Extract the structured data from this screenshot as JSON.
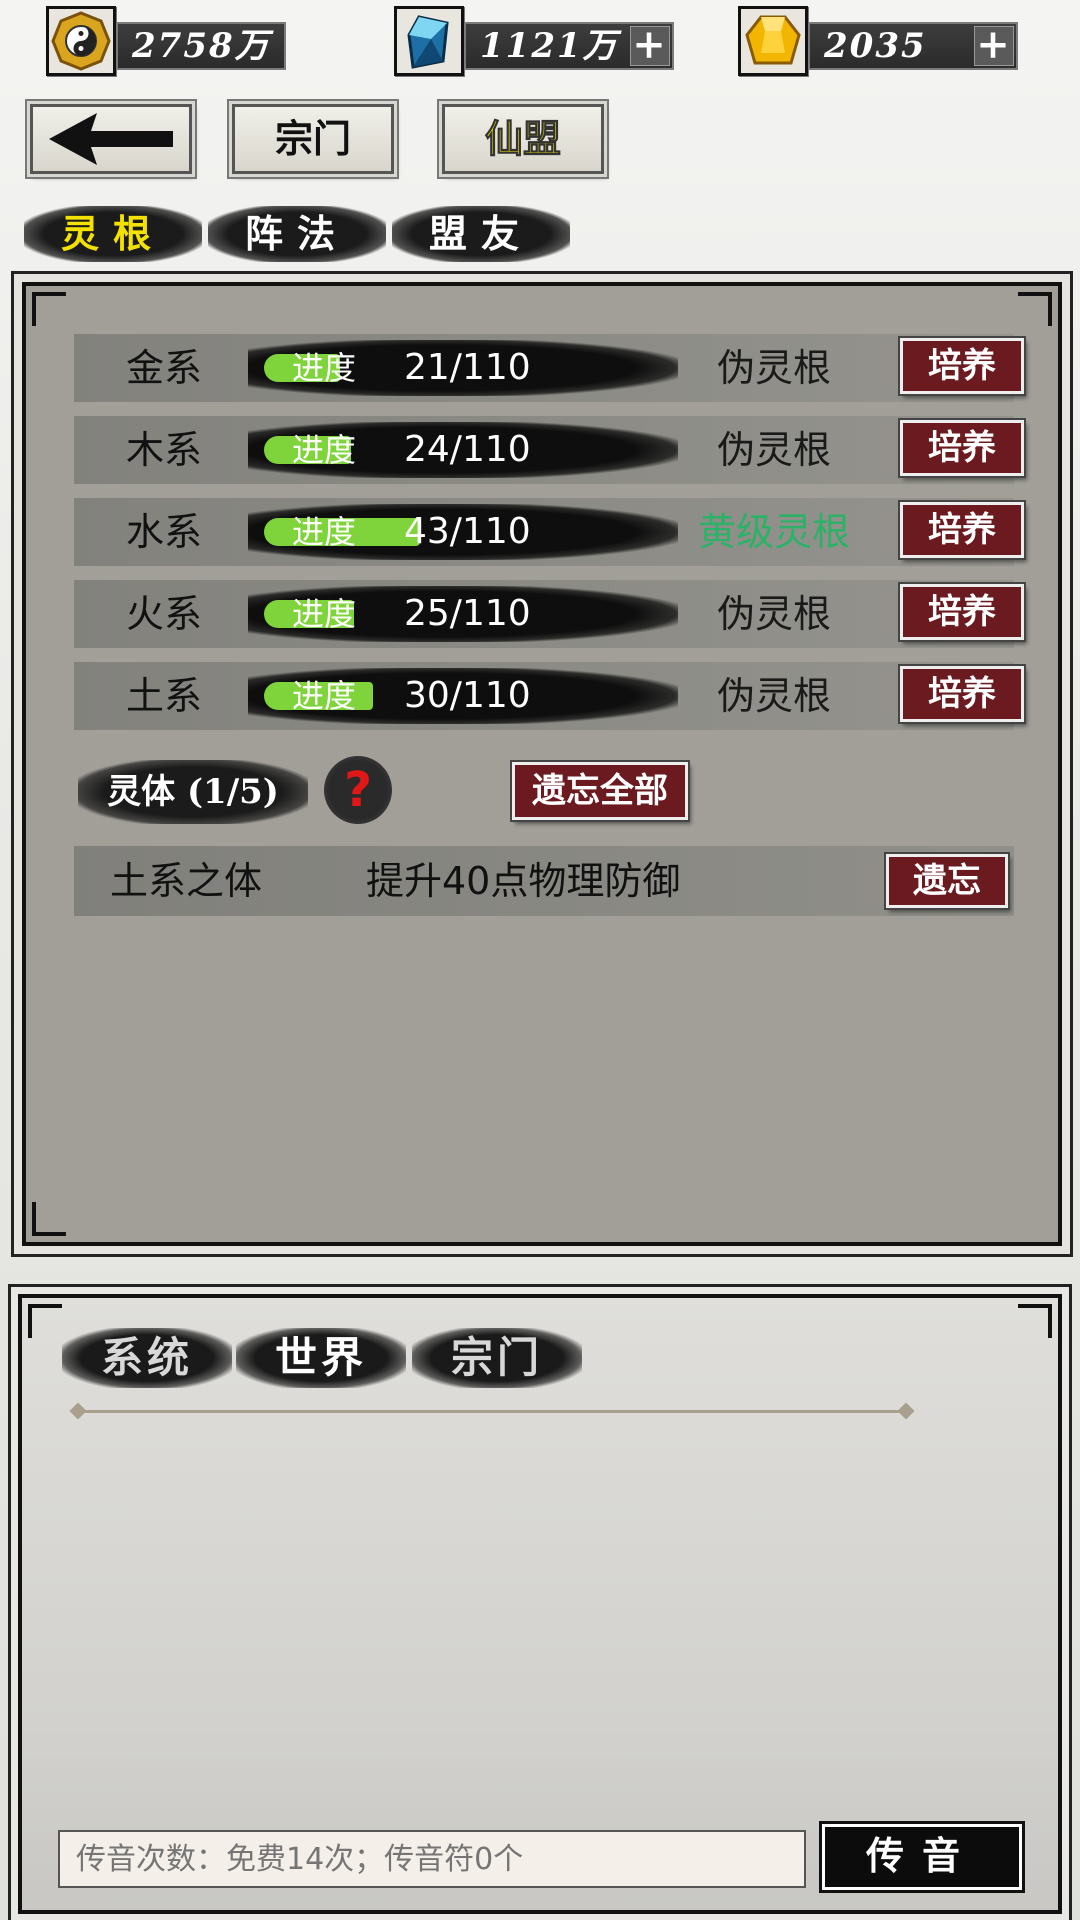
{
  "currency": {
    "coins": {
      "icon": "taiji-coin-icon",
      "value": "2758万"
    },
    "crystals": {
      "icon": "blue-crystal-icon",
      "value": "1121万"
    },
    "gold": {
      "icon": "gold-gem-icon",
      "value": "2035"
    },
    "plus": "+"
  },
  "nav": {
    "back_icon": "back-arrow-icon",
    "sect_label": "宗门",
    "alliance_label": "仙盟"
  },
  "tabs": [
    {
      "label": "灵根",
      "active": true
    },
    {
      "label": "阵法",
      "active": false
    },
    {
      "label": "盟友",
      "active": false
    }
  ],
  "spirit_roots": {
    "progress_label": "进度",
    "cultivate_label": "培养",
    "rows": [
      {
        "name": "金系",
        "progress": "21/110",
        "current": 21,
        "max": 110,
        "grade": "伪灵根",
        "grade_color": "#1a1a1a"
      },
      {
        "name": "木系",
        "progress": "24/110",
        "current": 24,
        "max": 110,
        "grade": "伪灵根",
        "grade_color": "#1a1a1a"
      },
      {
        "name": "水系",
        "progress": "43/110",
        "current": 43,
        "max": 110,
        "grade": "黄级灵根",
        "grade_color": "#2bb267"
      },
      {
        "name": "火系",
        "progress": "25/110",
        "current": 25,
        "max": 110,
        "grade": "伪灵根",
        "grade_color": "#1a1a1a"
      },
      {
        "name": "土系",
        "progress": "30/110",
        "current": 30,
        "max": 110,
        "grade": "伪灵根",
        "grade_color": "#1a1a1a"
      }
    ]
  },
  "spirit_body": {
    "title": "灵体 (1/5)",
    "help": "?",
    "forget_all_label": "遗忘全部",
    "items": [
      {
        "name": "土系之体",
        "effect": "提升40点物理防御",
        "forget_label": "遗忘"
      }
    ]
  },
  "chat": {
    "tabs": [
      "系统",
      "世界",
      "宗门"
    ],
    "input_placeholder": "传音次数：免费14次；传音符0个",
    "send_label": "传音"
  },
  "colors": {
    "panel": "#a19f98",
    "button_red": "#6b1a1f",
    "progress_green": "#7ed43a",
    "active_tab_text": "#f3e200",
    "grade_highlight": "#2bb267"
  }
}
